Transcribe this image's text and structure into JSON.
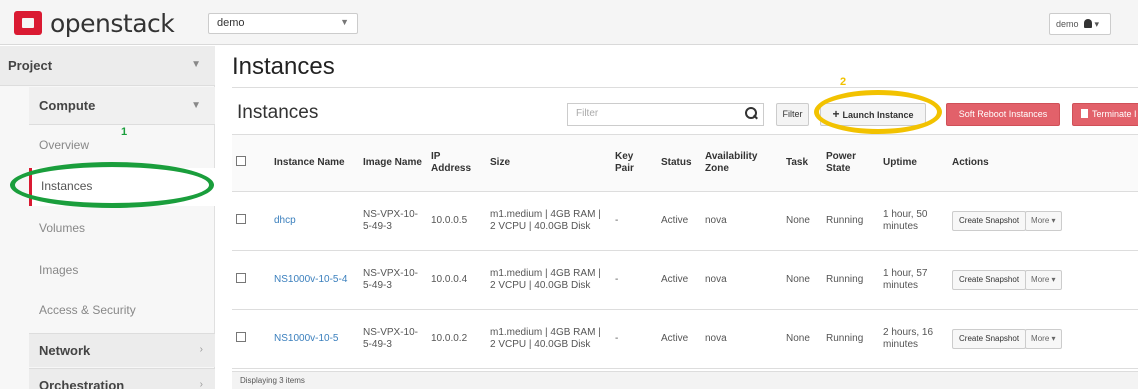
{
  "topbar": {
    "brand": "openstack",
    "project_selector": "demo",
    "user_menu": "demo"
  },
  "sidebar": {
    "project_label": "Project",
    "compute_label": "Compute",
    "items": [
      {
        "label": "Overview"
      },
      {
        "label": "Instances"
      },
      {
        "label": "Volumes"
      },
      {
        "label": "Images"
      },
      {
        "label": "Access & Security"
      }
    ],
    "network_label": "Network",
    "orchestration_label": "Orchestration"
  },
  "annotations": {
    "step1": "1",
    "step2": "2",
    "step1_color": "#1a9e3c",
    "step2_color": "#f2c200"
  },
  "main": {
    "page_title": "Instances",
    "section_title": "Instances",
    "filter_placeholder": "Filter",
    "filter_button": "Filter",
    "launch_button": "Launch Instance",
    "soft_reboot_button": "Soft Reboot Instances",
    "terminate_button": "Terminate I"
  },
  "table": {
    "headers": {
      "instance_name": "Instance Name",
      "image_name": "Image Name",
      "ip_address": "IP Address",
      "size": "Size",
      "key_pair": "Key Pair",
      "status": "Status",
      "availability_zone": "Availability Zone",
      "task": "Task",
      "power_state": "Power State",
      "uptime": "Uptime",
      "actions": "Actions"
    },
    "rows": [
      {
        "instance_name": "dhcp",
        "image_name": "NS-VPX-10-5-49-3",
        "ip": "10.0.0.5",
        "size": "m1.medium | 4GB RAM | 2 VCPU | 40.0GB Disk",
        "key_pair": "-",
        "status": "Active",
        "zone": "nova",
        "task": "None",
        "power_state": "Running",
        "uptime": "1 hour, 50 minutes",
        "action": "Create Snapshot",
        "more": "More"
      },
      {
        "instance_name": "NS1000v-10-5-4",
        "image_name": "NS-VPX-10-5-49-3",
        "ip": "10.0.0.4",
        "size": "m1.medium | 4GB RAM | 2 VCPU | 40.0GB Disk",
        "key_pair": "-",
        "status": "Active",
        "zone": "nova",
        "task": "None",
        "power_state": "Running",
        "uptime": "1 hour, 57 minutes",
        "action": "Create Snapshot",
        "more": "More"
      },
      {
        "instance_name": "NS1000v-10-5",
        "image_name": "NS-VPX-10-5-49-3",
        "ip": "10.0.0.2",
        "size": "m1.medium | 4GB RAM | 2 VCPU | 40.0GB Disk",
        "key_pair": "-",
        "status": "Active",
        "zone": "nova",
        "task": "None",
        "power_state": "Running",
        "uptime": "2 hours, 16 minutes",
        "action": "Create Snapshot",
        "more": "More"
      }
    ],
    "footer": "Displaying 3 items"
  }
}
